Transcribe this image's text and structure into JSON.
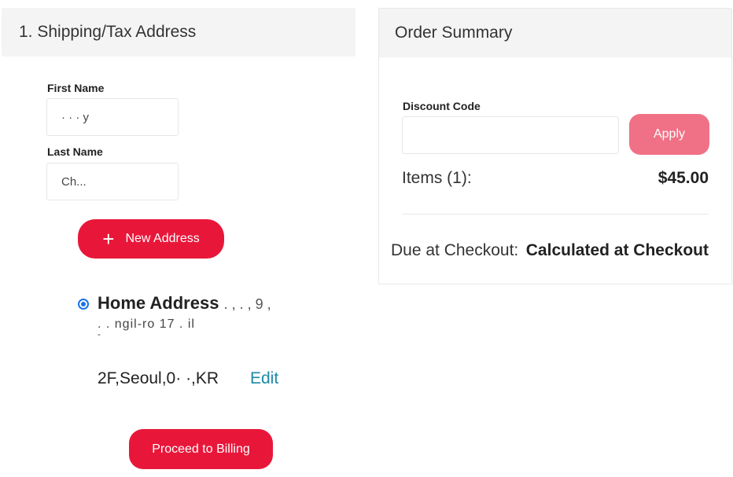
{
  "shipping": {
    "title": "1. Shipping/Tax Address",
    "first_name_label": "First Name",
    "first_name_value": "· · · y",
    "last_name_label": "Last Name",
    "last_name_value": "Ch...",
    "new_address_label": "New Address",
    "address": {
      "title": "Home Address",
      "title_suffix": ". , . , 9 ,",
      "line1": ". . ngil-ro 17 . il",
      "line2": "-",
      "line3": "2F,Seoul,0·  ·,KR",
      "edit_label": "Edit"
    },
    "proceed_label": "Proceed to Billing"
  },
  "order_summary": {
    "title": "Order Summary",
    "discount_label": "Discount Code",
    "discount_value": "",
    "apply_label": "Apply",
    "items_label": "Items (1):",
    "items_value": "$45.00",
    "due_label": "Due at Checkout:",
    "due_value": "Calculated at Checkout"
  },
  "colors": {
    "primary_red": "#e8173a",
    "apply_pink": "#f07186",
    "link_teal": "#1c8aa8",
    "radio_blue": "#1a73e8"
  },
  "icons": {
    "new_address": "plus-icon",
    "address_select": "radio-selected-icon"
  }
}
